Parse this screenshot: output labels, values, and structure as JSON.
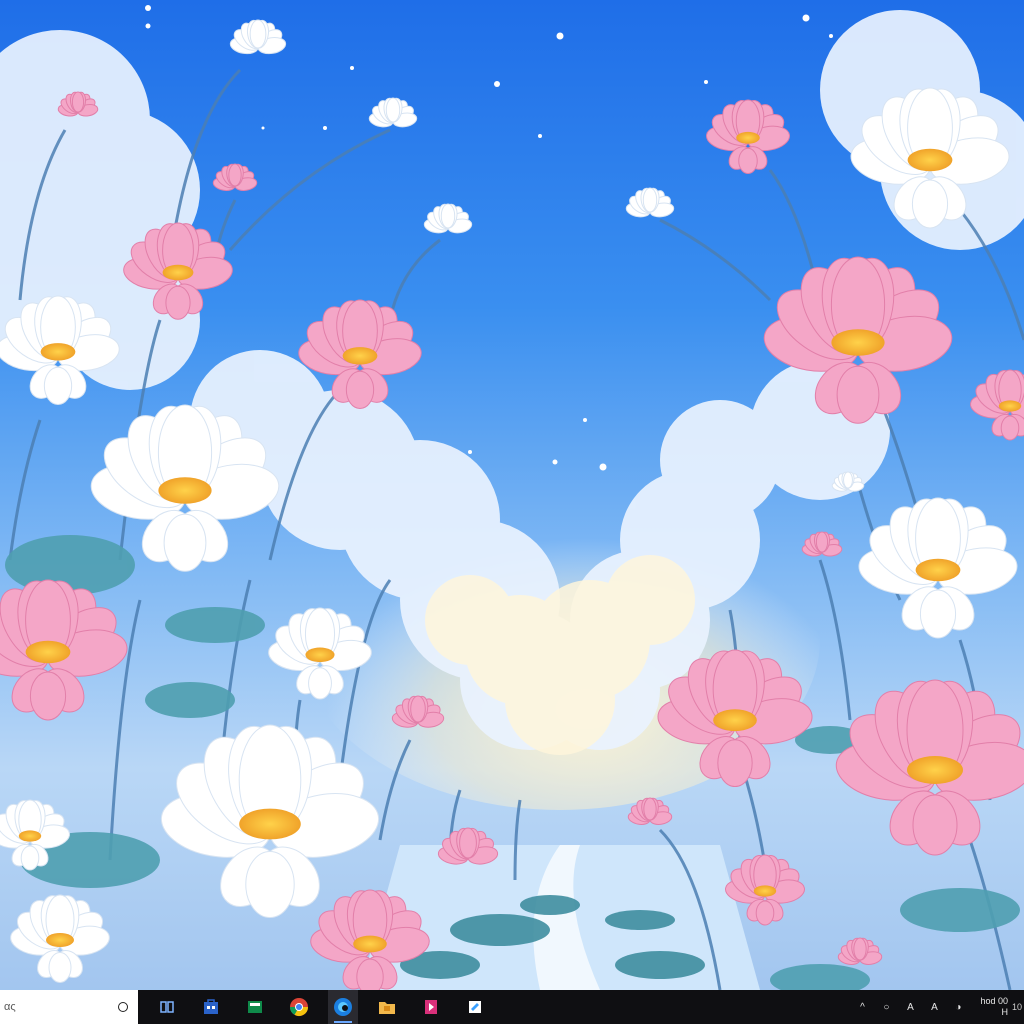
{
  "screen": {
    "type": "desktop-wallpaper"
  },
  "wallpaper": {
    "subject": "lotus-flowers-sky",
    "colors": {
      "sky_top": "#1f6ee8",
      "sky_mid": "#7fb8f4",
      "cloud": "#fbf4dc",
      "petal_pink": "#f4a6c7",
      "petal_white": "#ffffff",
      "flower_center": "#f7b733",
      "leaf": "#4f9fb0",
      "water": "#dcefff"
    }
  },
  "taskbar": {
    "search": {
      "placeholder": "ας",
      "icon": "search-icon"
    },
    "apps": [
      {
        "icon": "task-view-icon",
        "active": false
      },
      {
        "icon": "store-icon",
        "active": false
      },
      {
        "icon": "files-icon",
        "active": false
      },
      {
        "icon": "chrome-icon",
        "active": false
      },
      {
        "icon": "edge-icon",
        "active": true
      },
      {
        "icon": "folder-icon",
        "active": false
      },
      {
        "icon": "media-player-icon",
        "active": false
      },
      {
        "icon": "notepad-icon",
        "active": false
      }
    ],
    "tray": {
      "icons": [
        {
          "name": "chevron-up-icon",
          "glyph": "^"
        },
        {
          "name": "network-icon",
          "glyph": "○"
        },
        {
          "name": "font-icon",
          "glyph": "A"
        },
        {
          "name": "keyboard-icon",
          "glyph": "A"
        },
        {
          "name": "speaker-icon",
          "glyph": "◑"
        }
      ],
      "clock_time": "hod 00",
      "clock_date": "H",
      "clock_extra": "10"
    }
  }
}
